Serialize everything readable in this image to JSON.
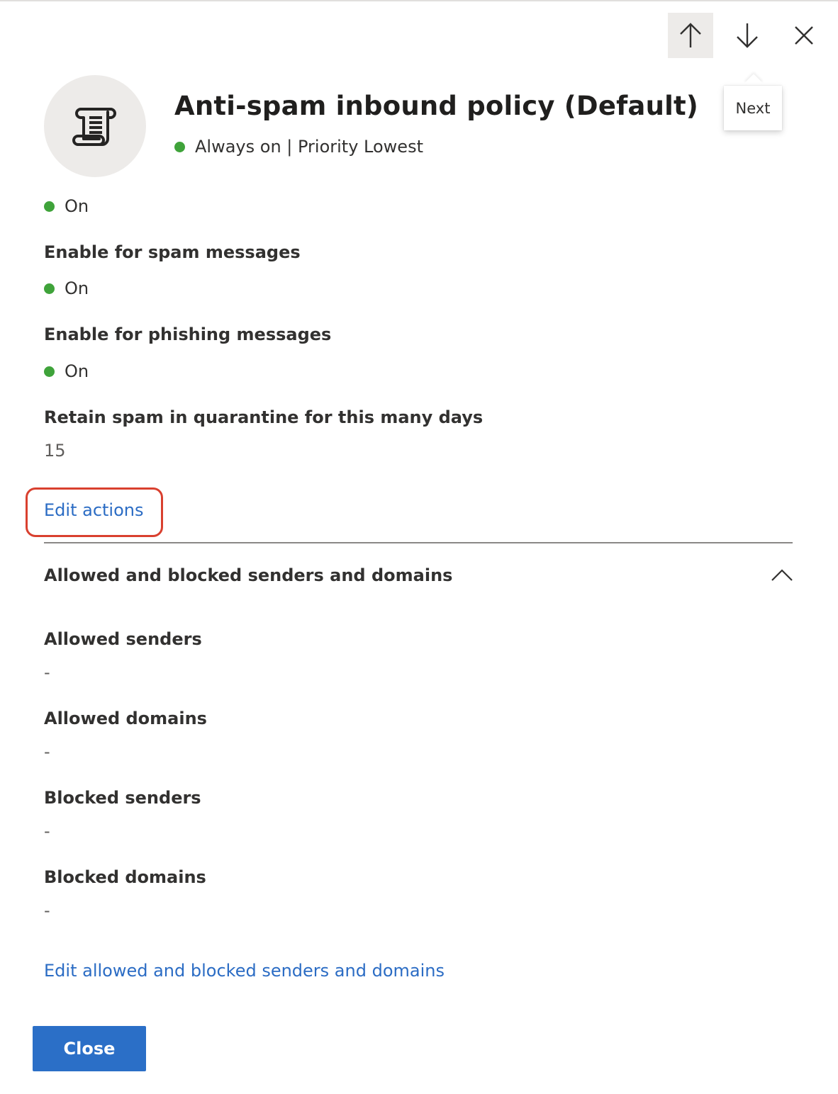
{
  "panel": {
    "nav": {
      "up_icon": "arrow-up-icon",
      "down_icon": "arrow-down-icon",
      "close_icon": "close-icon",
      "tooltip": "Next"
    },
    "header": {
      "avatar_icon": "script-scroll-icon",
      "title": "Anti-spam inbound policy (Default)",
      "subtitle": "Always on | Priority Lowest",
      "status_color": "#3fa33a"
    }
  },
  "actions": {
    "top_status": "On",
    "fields": [
      {
        "label": "Enable for spam messages",
        "value": "On",
        "type": "status"
      },
      {
        "label": "Enable for phishing messages",
        "value": "On",
        "type": "status"
      },
      {
        "label": "Retain spam in quarantine for this many days",
        "value": "15",
        "type": "text"
      }
    ],
    "edit_link": "Edit actions"
  },
  "senders_section": {
    "title": "Allowed and blocked senders and domains",
    "expanded": true,
    "chevron_icon": "chevron-up-icon",
    "fields": [
      {
        "label": "Allowed senders",
        "value": "-"
      },
      {
        "label": "Allowed domains",
        "value": "-"
      },
      {
        "label": "Blocked senders",
        "value": "-"
      },
      {
        "label": "Blocked domains",
        "value": "-"
      }
    ],
    "edit_link": "Edit allowed and blocked senders and domains"
  },
  "footer": {
    "close_label": "Close"
  },
  "colors": {
    "link": "#2b6cc4",
    "primary_button": "#2b6fc7",
    "highlight": "#d9402f",
    "status_on": "#3fa33a"
  }
}
